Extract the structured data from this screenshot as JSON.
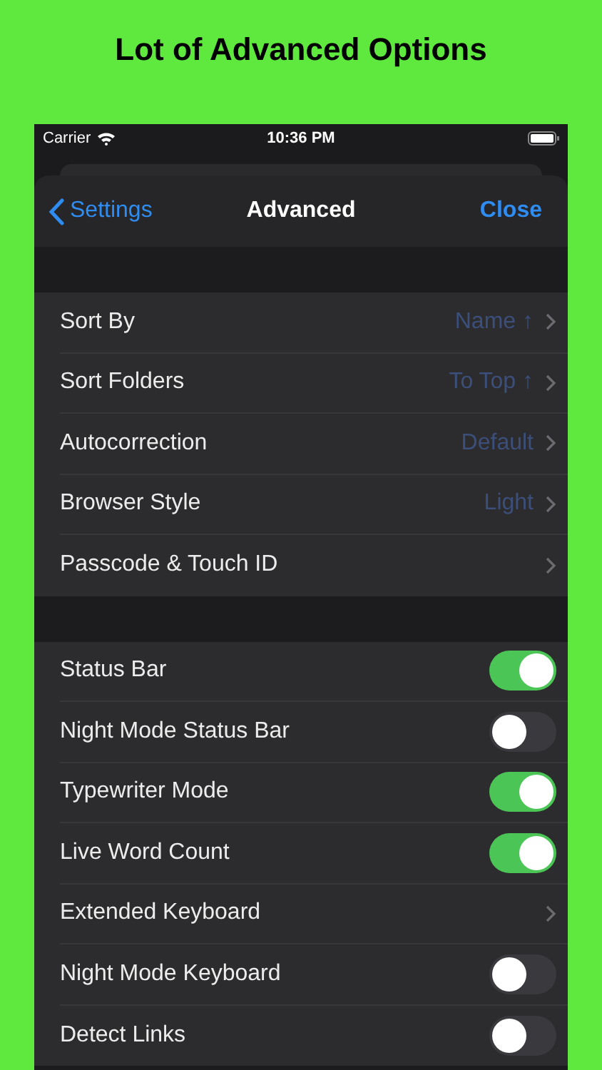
{
  "headline": "Lot of Advanced Options",
  "status_bar": {
    "carrier": "Carrier",
    "time": "10:36 PM"
  },
  "nav": {
    "back": "Settings",
    "title": "Advanced",
    "action": "Close"
  },
  "groups": [
    {
      "rows": [
        {
          "kind": "value",
          "label": "Sort By",
          "value": "Name ↑"
        },
        {
          "kind": "value",
          "label": "Sort Folders",
          "value": "To Top ↑"
        },
        {
          "kind": "value",
          "label": "Autocorrection",
          "value": "Default"
        },
        {
          "kind": "value",
          "label": "Browser Style",
          "value": "Light"
        },
        {
          "kind": "link",
          "label": "Passcode & Touch ID"
        }
      ]
    },
    {
      "rows": [
        {
          "kind": "toggle",
          "label": "Status Bar",
          "on": true
        },
        {
          "kind": "toggle",
          "label": "Night Mode Status Bar",
          "on": false
        },
        {
          "kind": "toggle",
          "label": "Typewriter Mode",
          "on": true
        },
        {
          "kind": "toggle",
          "label": "Live Word Count",
          "on": true
        },
        {
          "kind": "link",
          "label": "Extended Keyboard"
        },
        {
          "kind": "toggle",
          "label": "Night Mode Keyboard",
          "on": false
        },
        {
          "kind": "toggle",
          "label": "Detect Links",
          "on": false
        }
      ]
    }
  ]
}
